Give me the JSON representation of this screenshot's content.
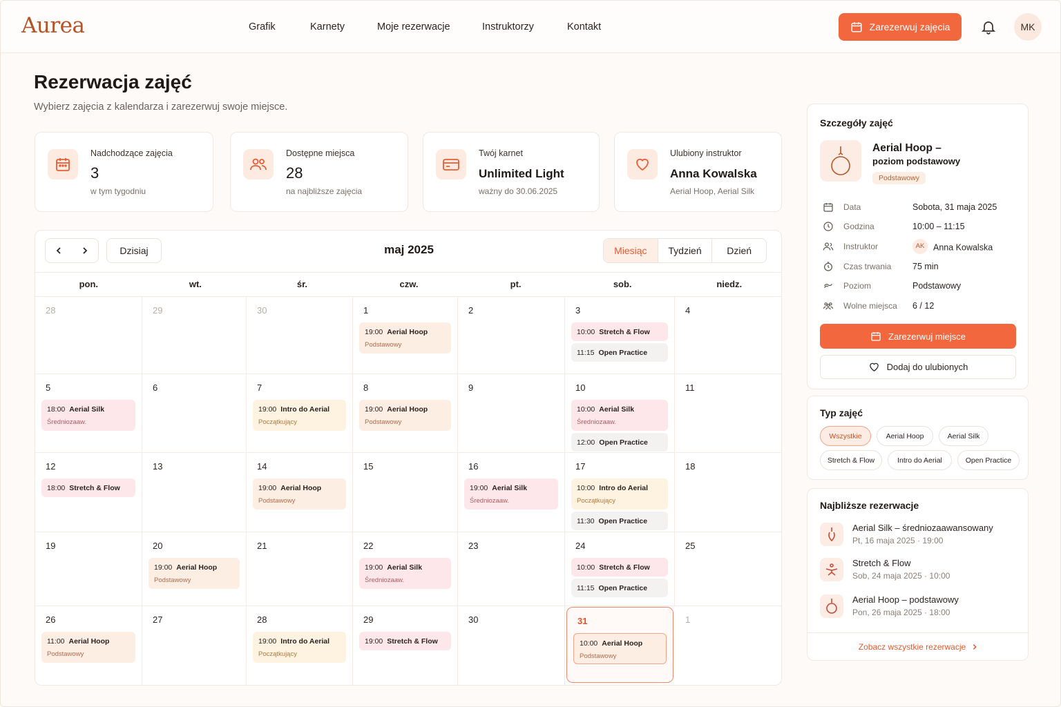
{
  "app": {
    "logo": "Aurea",
    "avatar_initials": "MK",
    "cta_label": "Zarezerwuj zajęcia"
  },
  "nav": [
    "Grafik",
    "Karnety",
    "Moje rezerwacje",
    "Instruktorzy",
    "Kontakt"
  ],
  "page": {
    "title": "Rezerwacja zajęć",
    "subtitle": "Wybierz zajęcia z kalendarza i zarezerwuj swoje miejsce."
  },
  "stats": [
    {
      "label": "Nadchodzące zajęcia",
      "value": "3",
      "note": "w tym tygodniu",
      "icon": "calendar-icon"
    },
    {
      "label": "Dostępne miejsca",
      "value": "28",
      "note": "na najbliższe zajęcia",
      "icon": "users-icon"
    },
    {
      "label": "Twój karnet",
      "value": "Unlimited Light",
      "note": "ważny do 30.06.2025",
      "icon": "card-icon"
    },
    {
      "label": "Ulubiony instruktor",
      "value": "Anna Kowalska",
      "note": "Aerial Hoop, Aerial Silk",
      "icon": "heart-icon"
    }
  ],
  "calendar": {
    "month_label": "maj 2025",
    "today_label": "Dzisiaj",
    "views": [
      "Miesiąc",
      "Tydzień",
      "Dzień"
    ],
    "active_view": "Miesiąc",
    "weekdays": [
      "pon.",
      "wt.",
      "śr.",
      "czw.",
      "pt.",
      "sob.",
      "niedz."
    ],
    "weeks": [
      [
        {
          "day": "28",
          "muted": true,
          "events": []
        },
        {
          "day": "29",
          "muted": true,
          "events": []
        },
        {
          "day": "30",
          "muted": true,
          "events": []
        },
        {
          "day": "1",
          "events": [
            {
              "time": "19:00",
              "name": "Aerial Hoop",
              "level": "Podstawowy",
              "color": "peach"
            }
          ]
        },
        {
          "day": "2",
          "events": []
        },
        {
          "day": "3",
          "events": [
            {
              "time": "10:00",
              "name": "Stretch & Flow",
              "color": "pink"
            },
            {
              "time": "11:15",
              "name": "Open Practice",
              "color": "grey"
            }
          ]
        },
        {
          "day": "4",
          "events": []
        }
      ],
      [
        {
          "day": "5",
          "events": [
            {
              "time": "18:00",
              "name": "Aerial Silk",
              "level": "Średniozaaw.",
              "color": "pink"
            }
          ]
        },
        {
          "day": "6",
          "events": []
        },
        {
          "day": "7",
          "events": [
            {
              "time": "19:00",
              "name": "Intro do Aerial",
              "level": "Początkujący",
              "color": "yellow"
            }
          ]
        },
        {
          "day": "8",
          "events": [
            {
              "time": "19:00",
              "name": "Aerial Hoop",
              "level": "Podstawowy",
              "color": "peach"
            }
          ]
        },
        {
          "day": "9",
          "events": []
        },
        {
          "day": "10",
          "events": [
            {
              "time": "10:00",
              "name": "Aerial Silk",
              "level": "Średniozaaw.",
              "color": "pink"
            },
            {
              "time": "12:00",
              "name": "Open Practice",
              "color": "grey"
            }
          ]
        },
        {
          "day": "11",
          "events": []
        }
      ],
      [
        {
          "day": "12",
          "events": [
            {
              "time": "18:00",
              "name": "Stretch & Flow",
              "color": "pink"
            }
          ]
        },
        {
          "day": "13",
          "events": []
        },
        {
          "day": "14",
          "events": [
            {
              "time": "19:00",
              "name": "Aerial Hoop",
              "level": "Podstawowy",
              "color": "peach"
            }
          ]
        },
        {
          "day": "15",
          "events": []
        },
        {
          "day": "16",
          "events": [
            {
              "time": "19:00",
              "name": "Aerial Silk",
              "level": "Średniozaaw.",
              "color": "pink"
            }
          ]
        },
        {
          "day": "17",
          "events": [
            {
              "time": "10:00",
              "name": "Intro do Aerial",
              "level": "Początkujący",
              "color": "yellow"
            },
            {
              "time": "11:30",
              "name": "Open Practice",
              "color": "grey"
            }
          ]
        },
        {
          "day": "18",
          "events": []
        }
      ],
      [
        {
          "day": "19",
          "events": []
        },
        {
          "day": "20",
          "events": [
            {
              "time": "19:00",
              "name": "Aerial Hoop",
              "level": "Podstawowy",
              "color": "peach"
            }
          ]
        },
        {
          "day": "21",
          "events": []
        },
        {
          "day": "22",
          "events": [
            {
              "time": "19:00",
              "name": "Aerial Silk",
              "level": "Średniozaaw.",
              "color": "pink"
            }
          ]
        },
        {
          "day": "23",
          "events": []
        },
        {
          "day": "24",
          "events": [
            {
              "time": "10:00",
              "name": "Stretch & Flow",
              "color": "pink"
            },
            {
              "time": "11:15",
              "name": "Open Practice",
              "color": "grey"
            }
          ]
        },
        {
          "day": "25",
          "events": []
        }
      ],
      [
        {
          "day": "26",
          "events": [
            {
              "time": "11:00",
              "name": "Aerial Hoop",
              "level": "Podstawowy",
              "color": "peach"
            }
          ]
        },
        {
          "day": "27",
          "events": []
        },
        {
          "day": "28",
          "events": [
            {
              "time": "19:00",
              "name": "Intro do Aerial",
              "level": "Początkujący",
              "color": "yellow"
            }
          ]
        },
        {
          "day": "29",
          "events": [
            {
              "time": "19:00",
              "name": "Stretch & Flow",
              "color": "pink"
            }
          ]
        },
        {
          "day": "30",
          "events": []
        },
        {
          "day": "31",
          "selected": true,
          "events": [
            {
              "time": "10:00",
              "name": "Aerial Hoop",
              "level": "Podstawowy",
              "color": "peach",
              "selected": true
            }
          ]
        },
        {
          "day": "1",
          "muted": true,
          "events": []
        }
      ]
    ]
  },
  "details": {
    "title": "Szczegóły zajęć",
    "class_name_1": "Aerial Hoop –",
    "class_name_2": "poziom podstawowy",
    "level_badge": "Podstawowy",
    "rows": [
      {
        "label": "Data",
        "value": "Sobota, 31 maja 2025",
        "icon": "calendar-icon"
      },
      {
        "label": "Godzina",
        "value": "10:00 – 11:15",
        "icon": "clock-icon"
      },
      {
        "label": "Instruktor",
        "value": "Anna Kowalska",
        "initials": "AK",
        "icon": "user-icon"
      },
      {
        "label": "Czas trwania",
        "value": "75 min",
        "icon": "timer-icon"
      },
      {
        "label": "Poziom",
        "value": "Podstawowy",
        "icon": "level-icon"
      },
      {
        "label": "Wolne miejsca",
        "value": "6 / 12",
        "icon": "people-icon"
      }
    ],
    "book_label": "Zarezerwuj miejsce",
    "fav_label": "Dodaj do ulubionych"
  },
  "types": {
    "title": "Typ zajęć",
    "chips": [
      "Wszystkie",
      "Aerial Hoop",
      "Aerial Silk",
      "Stretch & Flow",
      "Intro do Aerial",
      "Open Practice"
    ],
    "active": "Wszystkie"
  },
  "upcoming": {
    "title": "Najbliższe rezerwacje",
    "items": [
      {
        "name": "Aerial Silk – średniozaawansowany",
        "date": "Pt, 16 maja 2025 · 19:00",
        "icon": "silk-icon"
      },
      {
        "name": "Stretch & Flow",
        "date": "Sob, 24 maja 2025 · 10:00",
        "icon": "stretch-icon"
      },
      {
        "name": "Aerial Hoop – podstawowy",
        "date": "Pon, 26 maja 2025 · 18:00",
        "icon": "hoop-icon"
      }
    ],
    "see_all": "Zobacz wszystkie rezerwacje"
  },
  "colors": {
    "accent": "#f2673d",
    "accent_soft": "#fdece3",
    "text": "#2a2422"
  }
}
